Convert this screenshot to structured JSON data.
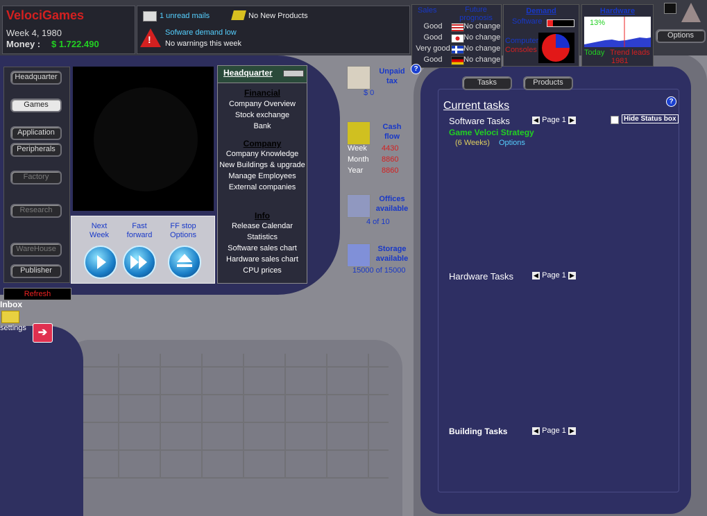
{
  "company": {
    "name": "VelociGames",
    "week": "Week 4, 1980",
    "money_label": "Money :",
    "money_value": "$ 1.722.490"
  },
  "messages": {
    "mails": "1 unread mails",
    "products": "No New Products",
    "warning_title": "Sofware demand low",
    "warning_text": "No warnings this week"
  },
  "sales": {
    "header": "Sales",
    "prognosis_header": "Future prognosis",
    "rows": [
      {
        "sales": "Good",
        "flag": "us-flag",
        "prognosis": "No change"
      },
      {
        "sales": "Good",
        "flag": "jp-flag",
        "prognosis": "No change"
      },
      {
        "sales": "Very good",
        "flag": "nordic-flag",
        "prognosis": "No change"
      },
      {
        "sales": "Good",
        "flag": "de-flag",
        "prognosis": "No change"
      }
    ]
  },
  "demand": {
    "title": "Demand",
    "software": "Software",
    "computer": "Computer",
    "consoles": "Consoles"
  },
  "hardware": {
    "title": "Hardware",
    "percent": "13%",
    "today": "Today",
    "trend": "Trend leads",
    "year": "1981"
  },
  "options_btn": "Options",
  "left_menu": [
    "Headquarter",
    "Games",
    "Application",
    "Peripherals",
    "Factory",
    "Research",
    "WareHouse",
    "Publisher"
  ],
  "refresh": "Refresh",
  "inbox": "Inbox",
  "settings": "settings",
  "time_controls": [
    {
      "label1": "Next",
      "label2": "Week"
    },
    {
      "label1": "Fast",
      "label2": "forward"
    },
    {
      "label1": "FF stop",
      "label2": "Options"
    }
  ],
  "hq_panel": {
    "title": "Headquarter",
    "sections": [
      {
        "head": "Financial",
        "items": [
          "Company Overview",
          "Stock exchange",
          "Bank"
        ]
      },
      {
        "head": "Company",
        "items": [
          "Company Knowledge",
          "New Buildings & upgrade",
          "Manage Employees",
          "External companies"
        ]
      },
      {
        "head": "Info",
        "items": [
          "Release Calendar",
          "Statistics",
          "Software sales chart",
          "Hardware sales chart",
          "CPU prices"
        ]
      }
    ]
  },
  "stats": {
    "tax": {
      "label": "Unpaid tax",
      "value": "$ 0"
    },
    "cash": {
      "label": "Cash flow",
      "rows": [
        {
          "k": "Week",
          "v": "4430"
        },
        {
          "k": "Month",
          "v": "8860"
        },
        {
          "k": "Year",
          "v": "8860"
        }
      ]
    },
    "offices": {
      "label": "Offices available",
      "value": "4 of 10"
    },
    "storage": {
      "label": "Storage available",
      "value": "15000 of 15000"
    }
  },
  "tabs": {
    "tasks": "Tasks",
    "products": "Products"
  },
  "tasks": {
    "title": "Current tasks",
    "hide_status": "Hide Status box",
    "software_header": "Software Tasks",
    "page_label": "Page 1",
    "software_items": [
      {
        "name": "Game Veloci Strategy",
        "weeks": "(6 Weeks)",
        "options": "Options"
      }
    ],
    "hardware_header": "Hardware Tasks",
    "building_header": "Building Tasks"
  }
}
